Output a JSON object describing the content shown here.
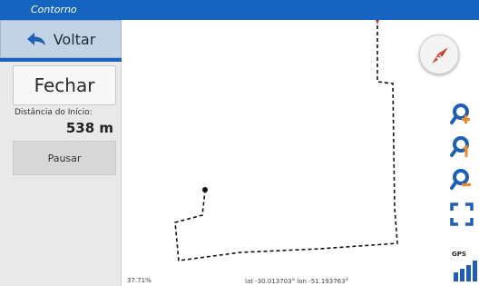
{
  "app": {
    "title": "Contorno"
  },
  "sidebar": {
    "back_label": "Voltar",
    "close_label": "Fechar",
    "distance_label": "Distância do Início:",
    "distance_value": "538 m",
    "pause_label": "Pausar"
  },
  "map": {
    "zoom_percent": "37.71%",
    "coordinates": "lat -30.013703°  lon -51.193763°"
  },
  "tools": {
    "icons": [
      "compass-icon",
      "zoom-in-icon",
      "zoom-reset-icon",
      "zoom-out-icon",
      "fullscreen-icon",
      "gps-signal-icon"
    ],
    "gps_label": "GPS"
  },
  "colors": {
    "title_bar": "#1565c0",
    "back_button": "#c3d3e6",
    "tool_blue": "#1e5fb4",
    "tool_orange": "#f08a24",
    "compass_red": "#b0322a",
    "track": "#111111"
  }
}
